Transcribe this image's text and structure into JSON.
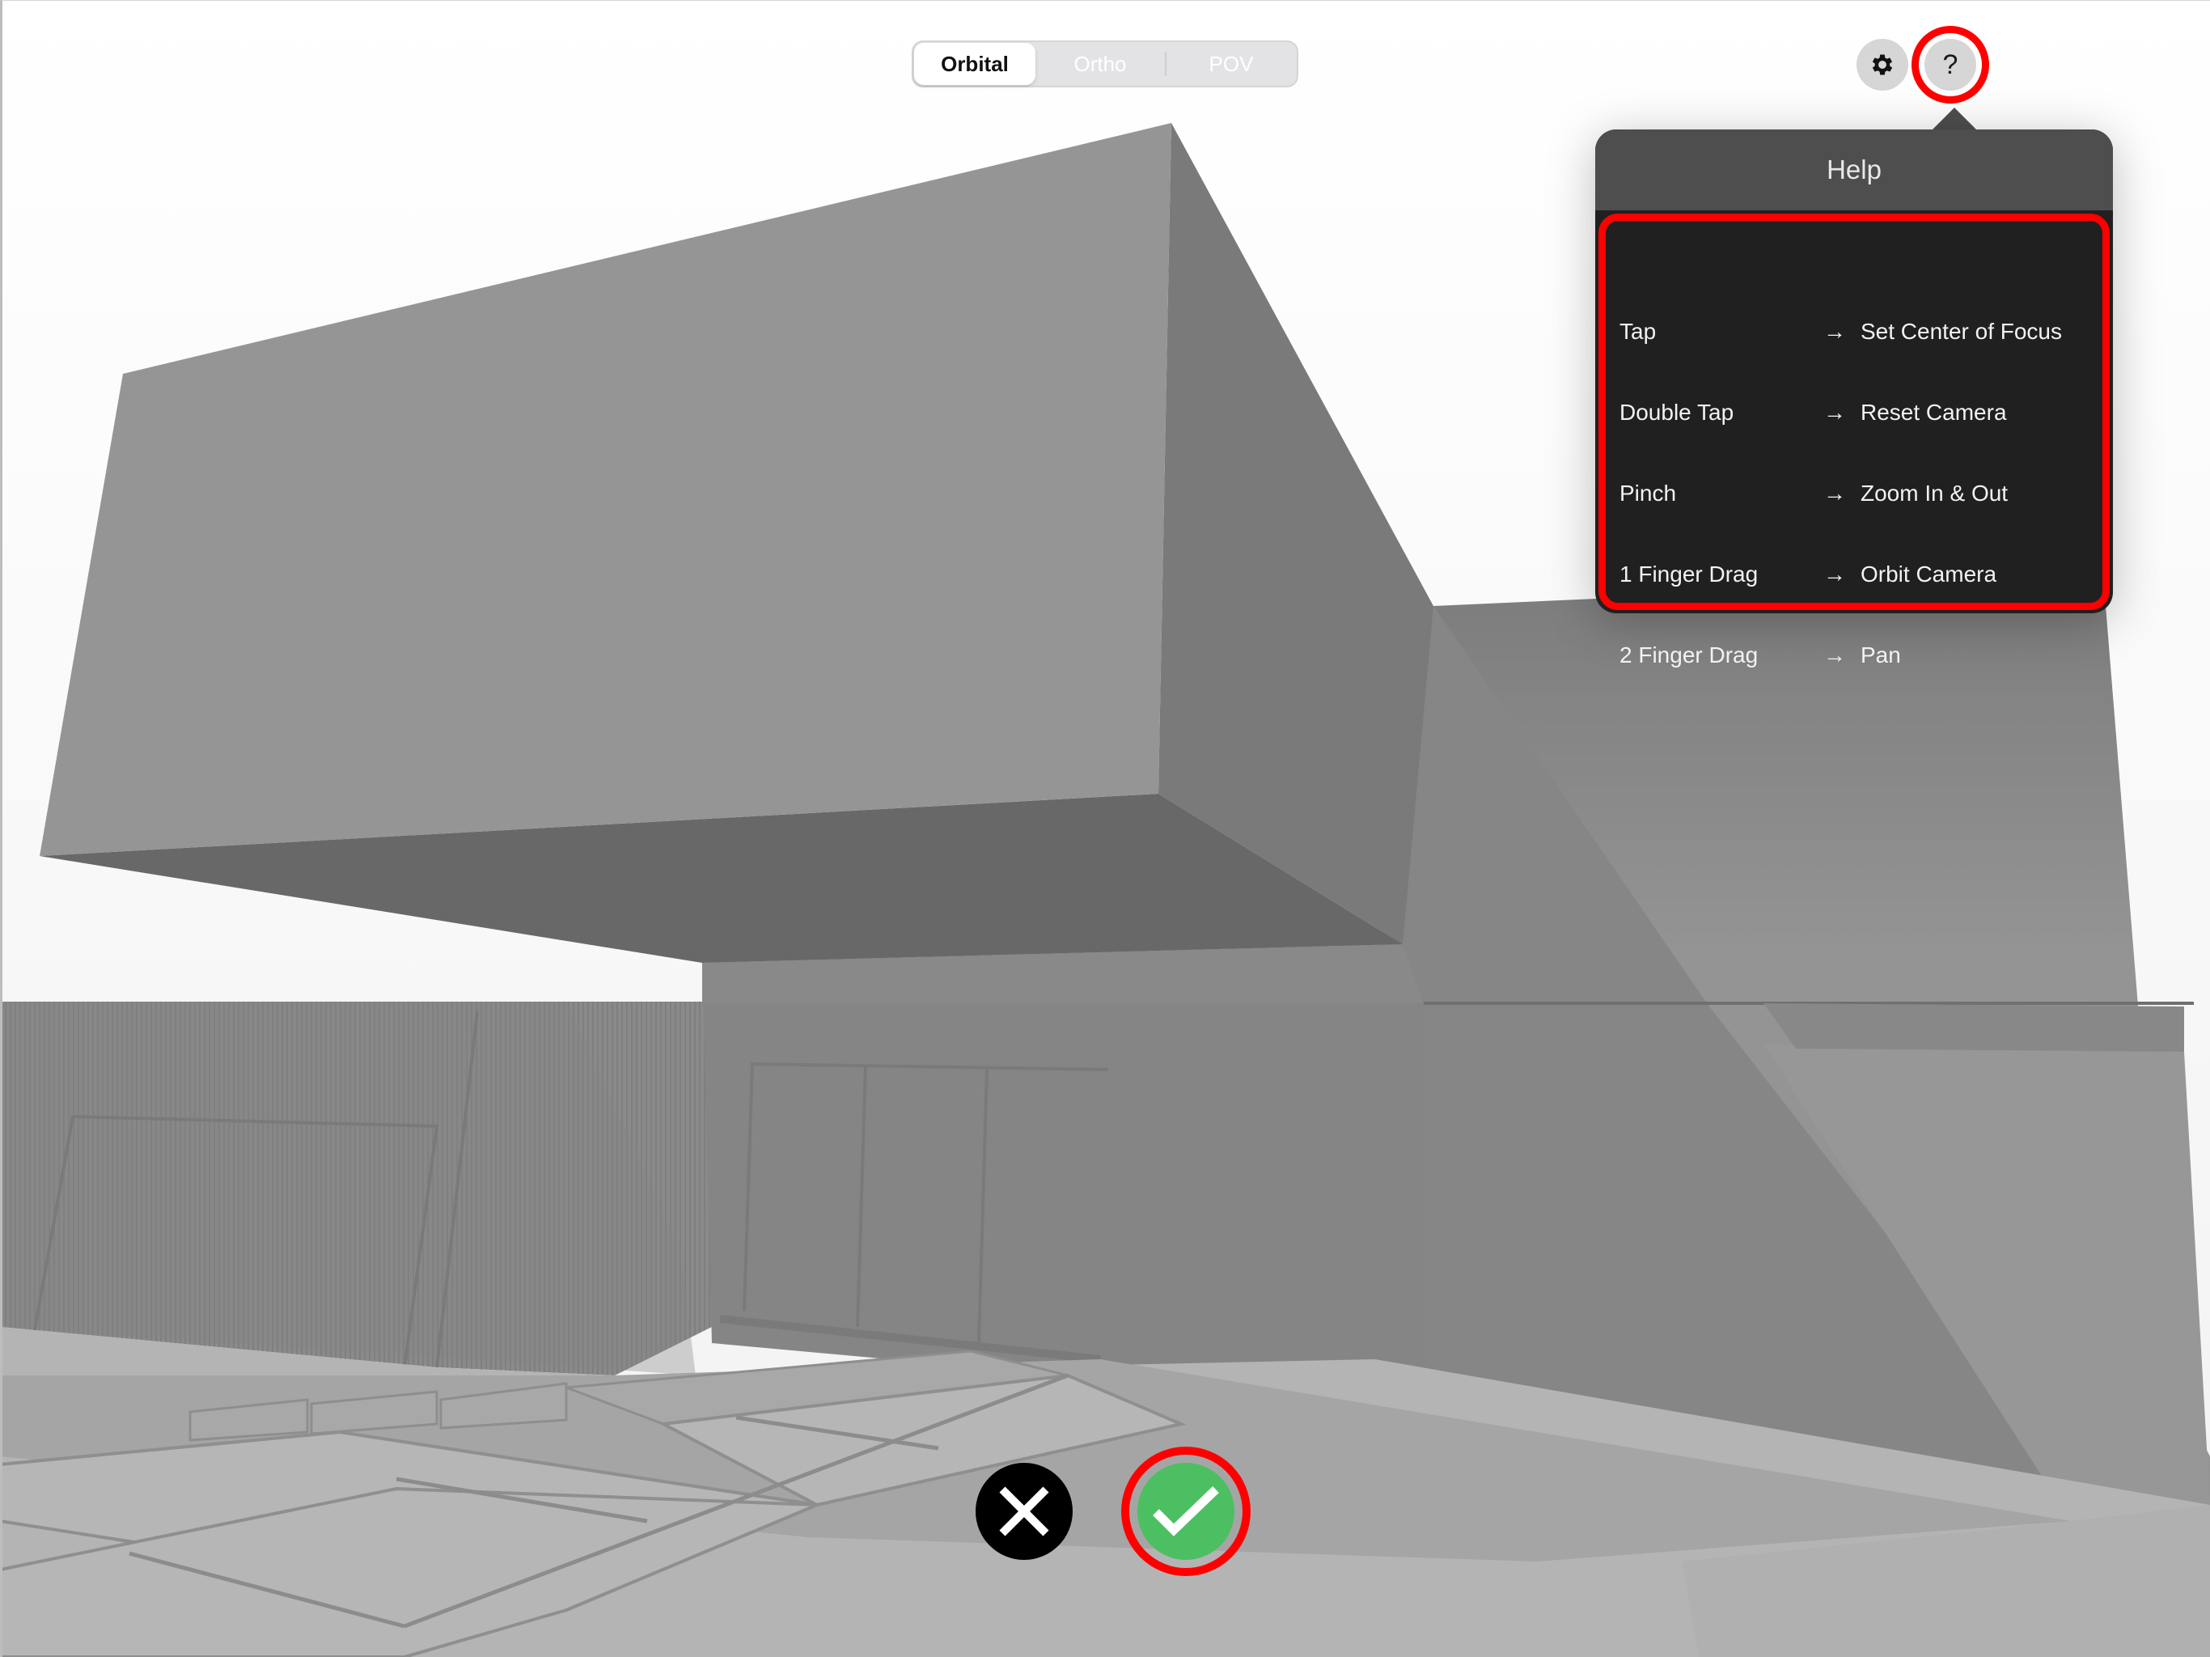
{
  "view_modes": {
    "options": [
      "Orbital",
      "Ortho",
      "POV"
    ],
    "selected": "Orbital"
  },
  "toolbar": {
    "settings_icon": "gear-icon",
    "help_label": "?"
  },
  "help_popover": {
    "title": "Help",
    "arrow_glyph": "→",
    "rows": [
      {
        "gesture": "Tap",
        "action": "Set Center of Focus"
      },
      {
        "gesture": "Double Tap",
        "action": "Reset Camera"
      },
      {
        "gesture": "Pinch",
        "action": "Zoom In & Out"
      },
      {
        "gesture": "1 Finger Drag",
        "action": "Orbit Camera"
      },
      {
        "gesture": "2 Finger Drag",
        "action": "Pan"
      }
    ]
  },
  "actions": {
    "cancel_icon": "close-icon",
    "confirm_icon": "checkmark-icon"
  },
  "colors": {
    "highlight": "#ff0000",
    "confirm": "#4cbf62",
    "cancel": "#000000",
    "popover_header": "#4e4e4e",
    "popover_body": "#202020"
  }
}
